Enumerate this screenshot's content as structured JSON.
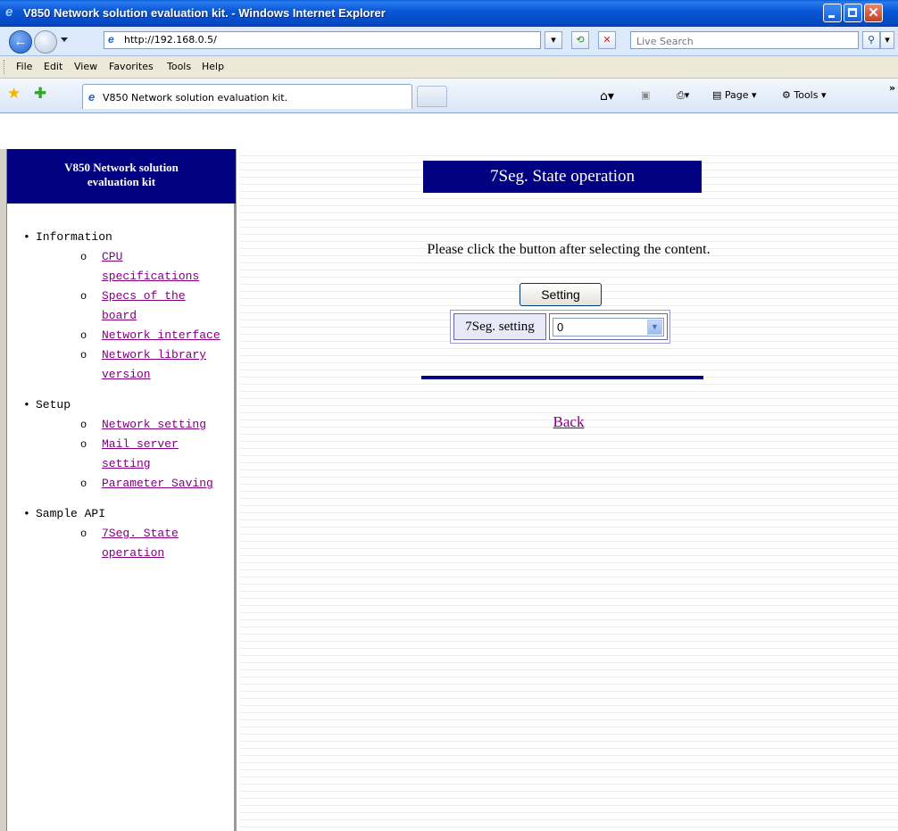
{
  "window": {
    "title": "V850 Network solution evaluation kit. - Windows Internet Explorer"
  },
  "address": {
    "url": "http://192.168.0.5/",
    "search_placeholder": "Live Search"
  },
  "menu": [
    "File",
    "Edit",
    "View",
    "Favorites",
    "Tools",
    "Help"
  ],
  "tab": {
    "label": "V850 Network solution evaluation kit."
  },
  "commands": {
    "page": "Page",
    "tools": "Tools"
  },
  "sidebar": {
    "title_line1": "V850 Network solution",
    "title_line2": "evaluation kit",
    "sections": [
      {
        "title": "Information",
        "items": [
          "CPU specifications",
          "Specs of the board",
          "Network interface",
          "Network library version"
        ]
      },
      {
        "title": "Setup",
        "items": [
          "Network setting",
          "Mail server setting",
          "Parameter Saving"
        ]
      },
      {
        "title": "Sample API",
        "items": [
          "7Seg. State operation"
        ]
      }
    ]
  },
  "main": {
    "heading": "7Seg. State operation",
    "instruction": "Please click the button after selecting the content.",
    "setting_button": "Setting",
    "setting_label": "7Seg. setting",
    "setting_value": "0",
    "back_link": "Back"
  }
}
